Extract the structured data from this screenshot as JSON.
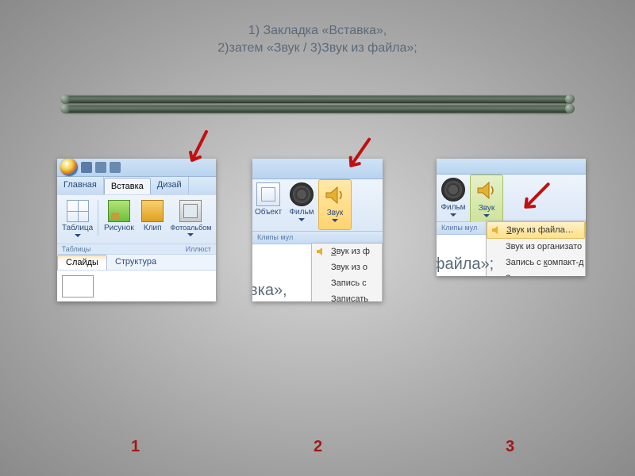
{
  "title_line1": "1) Закладка «Вставка»,",
  "title_line2": "2)затем  «Звук / 3)Звук из файла»;",
  "labels": {
    "n1": "1",
    "n2": "2",
    "n3": "3"
  },
  "shot1": {
    "tabs": {
      "home": "Главная",
      "insert": "Вставка",
      "design": "Дизай"
    },
    "ribbon": {
      "table": "Таблица",
      "picture": "Рисунок",
      "clip": "Клип",
      "photoalbum": "Фотоальбом",
      "group_tables": "Таблицы",
      "group_illust": "Иллюст"
    },
    "panes": {
      "slides": "Слайды",
      "structure": "Структура"
    }
  },
  "shot2": {
    "buttons": {
      "object": "Объект",
      "movie": "Фильм",
      "sound": "Звук"
    },
    "group": "Клипы мул",
    "menu": {
      "from_file": "Звук из ф",
      "from_org": "Звук из о",
      "record_cd": "Запись с",
      "record": "Записать"
    },
    "bgtext": "вка»,"
  },
  "shot3": {
    "buttons": {
      "movie": "Фильм",
      "sound": "Звук"
    },
    "group": "Клипы мул",
    "menu": {
      "from_file": "Звук из файла…",
      "from_org": "Звук из организато",
      "record_cd": "Запись с компакт-д",
      "record": "Записать звук"
    },
    "bgtext": "файла»;"
  }
}
